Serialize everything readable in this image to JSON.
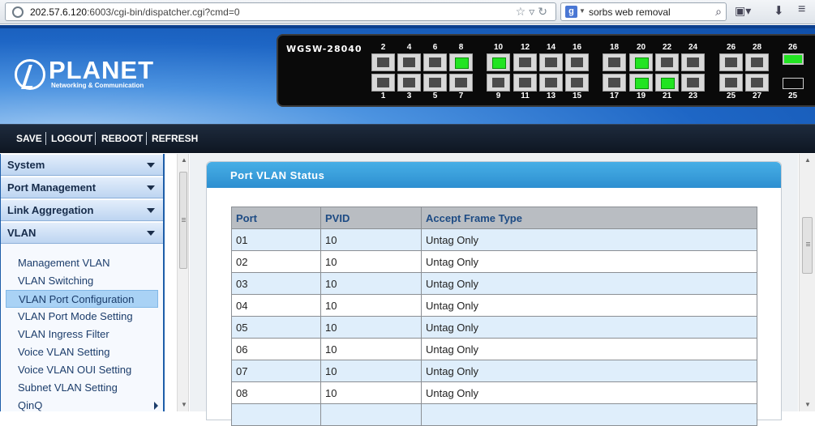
{
  "browser": {
    "url_host": "202.57.6.120",
    "url_path": ":6003/cgi-bin/dispatcher.cgi?cmd=0",
    "search_engine_letter": "g",
    "search_text": "sorbs web removal"
  },
  "header": {
    "brand": "PLANET",
    "tagline": "Networking & Communication",
    "switch_model": "WGSW-28040",
    "ports_top": [
      {
        "num": "2",
        "active": false
      },
      {
        "num": "4",
        "active": false
      },
      {
        "num": "6",
        "active": false
      },
      {
        "num": "8",
        "active": true
      },
      {
        "num": "10",
        "active": true
      },
      {
        "num": "12",
        "active": false
      },
      {
        "num": "14",
        "active": false
      },
      {
        "num": "16",
        "active": false
      },
      {
        "num": "18",
        "active": false
      },
      {
        "num": "20",
        "active": true
      },
      {
        "num": "22",
        "active": false
      },
      {
        "num": "24",
        "active": false
      },
      {
        "num": "26",
        "active": false
      },
      {
        "num": "28",
        "active": false
      }
    ],
    "ports_bottom": [
      {
        "num": "1",
        "active": false
      },
      {
        "num": "3",
        "active": false
      },
      {
        "num": "5",
        "active": false
      },
      {
        "num": "7",
        "active": false
      },
      {
        "num": "9",
        "active": false
      },
      {
        "num": "11",
        "active": false
      },
      {
        "num": "13",
        "active": false
      },
      {
        "num": "15",
        "active": false
      },
      {
        "num": "17",
        "active": false
      },
      {
        "num": "19",
        "active": true
      },
      {
        "num": "21",
        "active": true
      },
      {
        "num": "23",
        "active": false
      },
      {
        "num": "25",
        "active": false
      },
      {
        "num": "27",
        "active": false
      }
    ],
    "fiber_ports": [
      {
        "num": "26",
        "active": true
      },
      {
        "num": "25",
        "active": false
      }
    ]
  },
  "top_nav": {
    "save": "SAVE",
    "logout": "LOGOUT",
    "reboot": "REBOOT",
    "refresh": "REFRESH"
  },
  "sidebar": {
    "categories": {
      "system": "System",
      "port_management": "Port Management",
      "link_aggregation": "Link Aggregation",
      "vlan": "VLAN"
    },
    "vlan_items": [
      "Management VLAN",
      "VLAN Switching",
      "VLAN Port Configuration",
      "VLAN Port Mode Setting",
      "VLAN Ingress Filter",
      "Voice VLAN Setting",
      "Voice VLAN OUI Setting",
      "Subnet VLAN Setting",
      "QinQ"
    ],
    "selected_item": "VLAN Port Configuration"
  },
  "main": {
    "panel_title": "Port VLAN Status",
    "columns": [
      "Port",
      "PVID",
      "Accept Frame Type"
    ],
    "rows": [
      [
        "01",
        "10",
        "Untag Only"
      ],
      [
        "02",
        "10",
        "Untag Only"
      ],
      [
        "03",
        "10",
        "Untag Only"
      ],
      [
        "04",
        "10",
        "Untag Only"
      ],
      [
        "05",
        "10",
        "Untag Only"
      ],
      [
        "06",
        "10",
        "Untag Only"
      ],
      [
        "07",
        "10",
        "Untag Only"
      ],
      [
        "08",
        "10",
        "Untag Only"
      ]
    ]
  },
  "colors": {
    "header_blue": "#1e66c5",
    "nav_dark": "#0e1622",
    "panel_title": "#2d8fd0",
    "port_active": "#22e422",
    "table_row_alt": "#dfeefb"
  }
}
